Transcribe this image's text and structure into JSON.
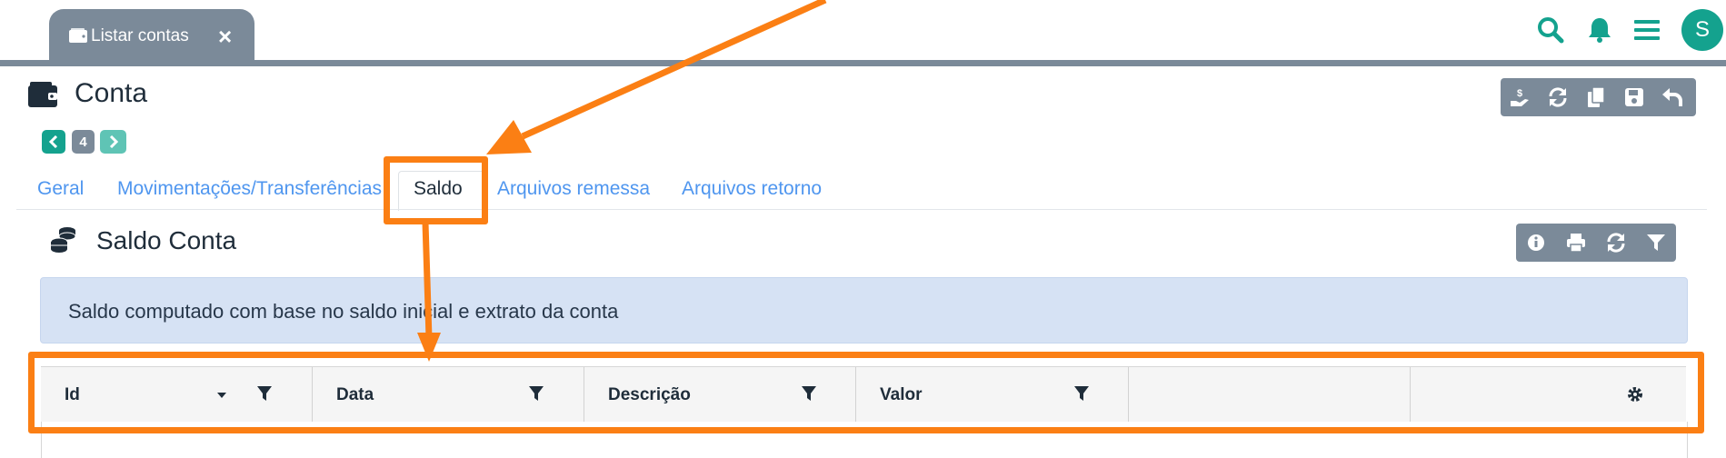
{
  "topbar": {
    "tab_label": "Listar contas",
    "tab_close": "×",
    "icons": [
      "search-icon",
      "bell-icon",
      "menu-icon"
    ],
    "avatar_initial": "S"
  },
  "page": {
    "title": "Conta",
    "record_count": "4",
    "toolbar_icons": [
      "money-hand-icon",
      "refresh-icon",
      "copy-icon",
      "save-icon",
      "undo-icon"
    ]
  },
  "tabs": [
    {
      "label": "Geral",
      "active": false
    },
    {
      "label": "Movimentações/Transferências",
      "active": false
    },
    {
      "label": "Saldo",
      "active": true
    },
    {
      "label": "Arquivos remessa",
      "active": false
    },
    {
      "label": "Arquivos retorno",
      "active": false
    }
  ],
  "section": {
    "title": "Saldo Conta",
    "toolbar_icons": [
      "info-icon",
      "print-icon",
      "refresh-icon",
      "filter-icon"
    ],
    "info_text": "Saldo computado com base no saldo inicial e extrato da conta"
  },
  "grid": {
    "columns": [
      "Id",
      "Data",
      "Descrição",
      "Valor"
    ],
    "settings_icon": "gear-icon"
  },
  "colors": {
    "accent": "#14a28e",
    "toolbar": "#7b8a99",
    "link": "#4f96ef",
    "highlight": "#fb7f14",
    "info_bg": "#d6e2f4"
  }
}
